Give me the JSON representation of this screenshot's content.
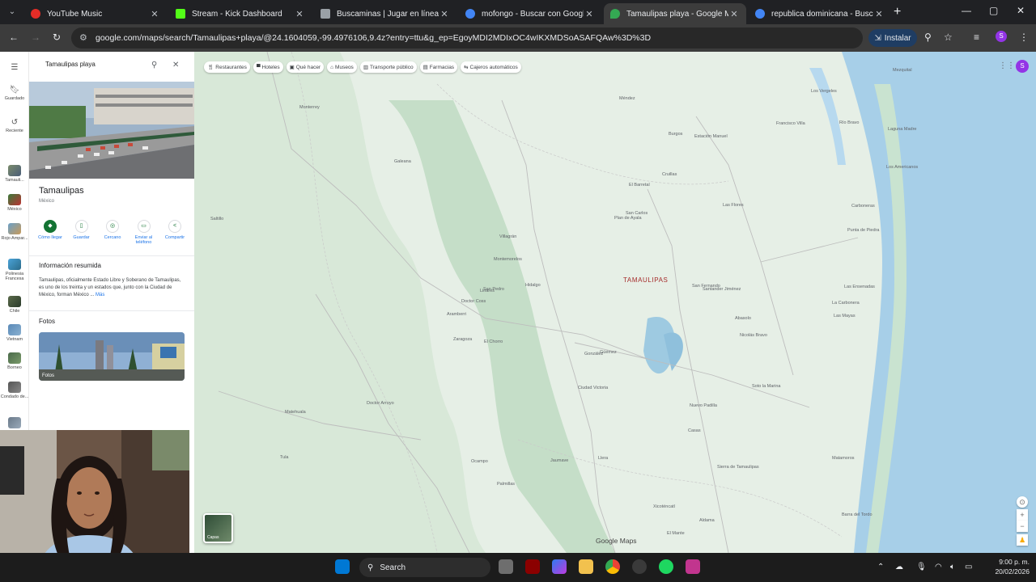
{
  "browser": {
    "tabs": [
      {
        "title": "YouTube Music",
        "color": "#e52d27"
      },
      {
        "title": "Stream - Kick Dashboard",
        "color": "#53fc18"
      },
      {
        "title": "Buscaminas | Jugar en línea gra",
        "color": "#9aa0a6"
      },
      {
        "title": "mofongo - Buscar con Google",
        "color": "#4285f4"
      },
      {
        "title": "Tamaulipas playa - Google Ma",
        "color": "#34a853"
      },
      {
        "title": "republica dominicana - Buscar c",
        "color": "#4285f4"
      }
    ],
    "active_tab": 4,
    "url": "google.com/maps/search/Tamaulipas+playa/@24.1604059,-99.4976106,9.4z?entry=ttu&g_ep=EgoyMDI2MDIxOC4wIKXMDSoASAFQAw%3D%3D",
    "install_label": "Instalar",
    "profile_initial": "S"
  },
  "rail": {
    "menu_icon": "menu-icon",
    "items": [
      {
        "label": "Guardado",
        "icon": "bookmark-icon"
      },
      {
        "label": "Reciente",
        "icon": "history-icon"
      }
    ],
    "recent_places": [
      "Tamauli...",
      "México",
      "Rojo Ampar...",
      "Polinesia Francesa",
      "Chile",
      "Vietnam",
      "Borneo",
      "Condado de...",
      ""
    ]
  },
  "panel": {
    "search_value": "Tamaulipas playa",
    "place_name": "Tamaulipas",
    "place_country": "México",
    "actions": [
      {
        "label": "Cómo llegar",
        "icon": "directions-icon"
      },
      {
        "label": "Guardar",
        "icon": "bookmark-icon"
      },
      {
        "label": "Cercano",
        "icon": "nearby-icon"
      },
      {
        "label": "Enviar al teléfono",
        "icon": "send-to-phone-icon"
      },
      {
        "label": "Compartir",
        "icon": "share-icon"
      }
    ],
    "summary_heading": "Información resumida",
    "summary_text": "Tamaulipas, oficialmente Estado Libre y Soberano de Tamaulipas, es uno de los treinta y un estados que, junto con la Ciudad de México, forman México ... ",
    "summary_more": "Más",
    "photos_heading": "Fotos",
    "photos_label": "Fotos"
  },
  "map": {
    "chips": [
      {
        "label": "Restaurantes",
        "icon": "restaurant-icon"
      },
      {
        "label": "Hoteles",
        "icon": "hotel-icon"
      },
      {
        "label": "Qué hacer",
        "icon": "things-to-do-icon"
      },
      {
        "label": "Museos",
        "icon": "museum-icon"
      },
      {
        "label": "Transporte público",
        "icon": "transit-icon"
      },
      {
        "label": "Farmacias",
        "icon": "pharmacy-icon"
      },
      {
        "label": "Cajeros automáticos",
        "icon": "atm-icon"
      }
    ],
    "state_label": "TAMAULIPAS",
    "places": [
      {
        "name": "Mezquital"
      },
      {
        "name": "Río Bravo"
      },
      {
        "name": "Los Vergeles"
      },
      {
        "name": "Laguna Madre"
      },
      {
        "name": "Los Americanos"
      },
      {
        "name": "Carboneras"
      },
      {
        "name": "Punta de Piedra"
      },
      {
        "name": "Las Ensenadas"
      },
      {
        "name": "La Carbonera"
      },
      {
        "name": "Las Mayas"
      },
      {
        "name": "San Fernando"
      },
      {
        "name": "Burgos"
      },
      {
        "name": "Méndez"
      },
      {
        "name": "Cruillas"
      },
      {
        "name": "San Carlos"
      },
      {
        "name": "Villagrán"
      },
      {
        "name": "Hidalgo"
      },
      {
        "name": "Abasolo"
      },
      {
        "name": "Soto la Marina"
      },
      {
        "name": "Nuevo Padilla"
      },
      {
        "name": "Güémez"
      },
      {
        "name": "Ciudad Victoria"
      },
      {
        "name": "Casas"
      },
      {
        "name": "Llera"
      },
      {
        "name": "Aldama"
      },
      {
        "name": "Barra del Tordo"
      },
      {
        "name": "Linares"
      },
      {
        "name": "Montemorelos"
      },
      {
        "name": "Galeana"
      },
      {
        "name": "Aramberri"
      },
      {
        "name": "Zaragoza"
      },
      {
        "name": "Doctor Arroyo"
      },
      {
        "name": "Matehuala"
      },
      {
        "name": "Tula"
      },
      {
        "name": "Jaumave"
      },
      {
        "name": "Palmillas"
      },
      {
        "name": "Ocampo"
      },
      {
        "name": "Xicoténcatl"
      },
      {
        "name": "El Mante"
      },
      {
        "name": "Sierra de Tamaulipas"
      },
      {
        "name": "Monterrey"
      },
      {
        "name": "Saltillo"
      },
      {
        "name": "San Pedro"
      },
      {
        "name": "Doctor Coss"
      },
      {
        "name": "Las Flores"
      },
      {
        "name": "Nicolás Bravo"
      },
      {
        "name": "El Chorro"
      },
      {
        "name": "Plan de Ayala"
      },
      {
        "name": "González"
      },
      {
        "name": "El Barretal"
      },
      {
        "name": "Francisco Villa"
      },
      {
        "name": "Santander Jiménez"
      },
      {
        "name": "Matamoros"
      },
      {
        "name": "Estación Manuel"
      }
    ],
    "logo": "Google Maps",
    "layers_label": "Capas",
    "apps_icon": "apps-grid-icon"
  },
  "taskbar": {
    "search_label": "Search",
    "time": "9:00 p. m.",
    "date": "20/02/2026"
  }
}
